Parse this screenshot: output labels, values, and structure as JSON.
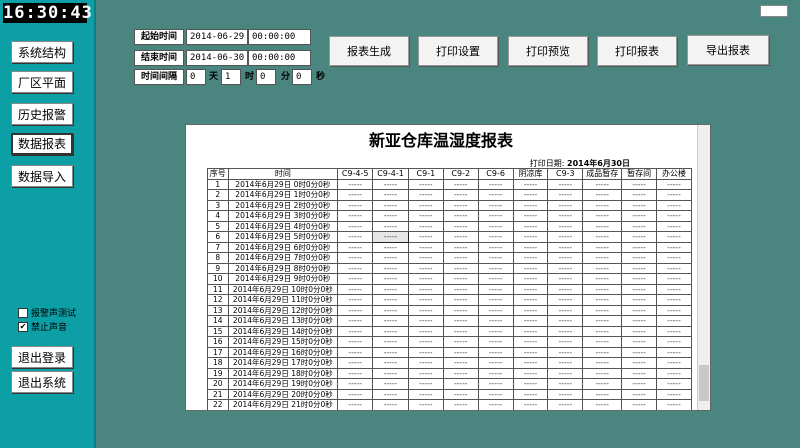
{
  "clock": "16:30:43",
  "sidebar": {
    "items": [
      {
        "label": "系统结构"
      },
      {
        "label": "厂区平面"
      },
      {
        "label": "历史报警"
      },
      {
        "label": "数据报表"
      },
      {
        "label": "数据导入"
      }
    ],
    "checkboxes": [
      {
        "label": "报警声测试",
        "checked": false,
        "mark": ""
      },
      {
        "label": "禁止声音",
        "checked": true,
        "mark": "✔"
      }
    ],
    "bottom": [
      {
        "label": "退出登录"
      },
      {
        "label": "退出系统"
      }
    ]
  },
  "query": {
    "start_label": "起始时间",
    "start_date": "2014-06-29",
    "start_time": "00:00:00",
    "end_label": "结束时间",
    "end_date": "2014-06-30",
    "end_time": "00:00:00",
    "interval_label": "时间间隔",
    "days": "0",
    "days_unit": "天",
    "hours": "1",
    "hours_unit": "时",
    "minutes": "0",
    "minutes_unit": "分",
    "seconds": "0",
    "seconds_unit": "秒"
  },
  "actions": [
    {
      "label": "报表生成"
    },
    {
      "label": "打印设置"
    },
    {
      "label": "打印预览"
    },
    {
      "label": "打印报表"
    },
    {
      "label": "导出报表"
    }
  ],
  "report": {
    "title": "新亚仓库温湿度报表",
    "print_date_label": "打印日期",
    "print_date": "2014年6月30日",
    "columns": [
      "序号",
      "时间",
      "C9-4-5",
      "C9-4-1",
      "C9-1",
      "C9-2",
      "C9-6",
      "阴凉库",
      "C9-3",
      "成品暂存",
      "暂存间",
      "办公楼"
    ],
    "empty_value": "-----",
    "rows": [
      {
        "no": "1",
        "time": "2014年6月29日 0时0分0秒"
      },
      {
        "no": "2",
        "time": "2014年6月29日 1时0分0秒"
      },
      {
        "no": "3",
        "time": "2014年6月29日 2时0分0秒"
      },
      {
        "no": "4",
        "time": "2014年6月29日 3时0分0秒"
      },
      {
        "no": "5",
        "time": "2014年6月29日 4时0分0秒"
      },
      {
        "no": "6",
        "time": "2014年6月29日 5时0分0秒"
      },
      {
        "no": "7",
        "time": "2014年6月29日 6时0分0秒"
      },
      {
        "no": "8",
        "time": "2014年6月29日 7时0分0秒"
      },
      {
        "no": "9",
        "time": "2014年6月29日 8时0分0秒"
      },
      {
        "no": "10",
        "time": "2014年6月29日 9时0分0秒"
      },
      {
        "no": "11",
        "time": "2014年6月29日 10时0分0秒"
      },
      {
        "no": "12",
        "time": "2014年6月29日 11时0分0秒"
      },
      {
        "no": "13",
        "time": "2014年6月29日 12时0分0秒"
      },
      {
        "no": "14",
        "time": "2014年6月29日 13时0分0秒"
      },
      {
        "no": "15",
        "time": "2014年6月29日 14时0分0秒"
      },
      {
        "no": "16",
        "time": "2014年6月29日 15时0分0秒"
      },
      {
        "no": "17",
        "time": "2014年6月29日 16时0分0秒"
      },
      {
        "no": "18",
        "time": "2014年6月29日 17时0分0秒"
      },
      {
        "no": "19",
        "time": "2014年6月29日 18时0分0秒"
      },
      {
        "no": "20",
        "time": "2014年6月29日 19时0分0秒"
      },
      {
        "no": "21",
        "time": "2014年6月29日 20时0分0秒"
      },
      {
        "no": "22",
        "time": "2014年6月29日 21时0分0秒"
      }
    ]
  }
}
